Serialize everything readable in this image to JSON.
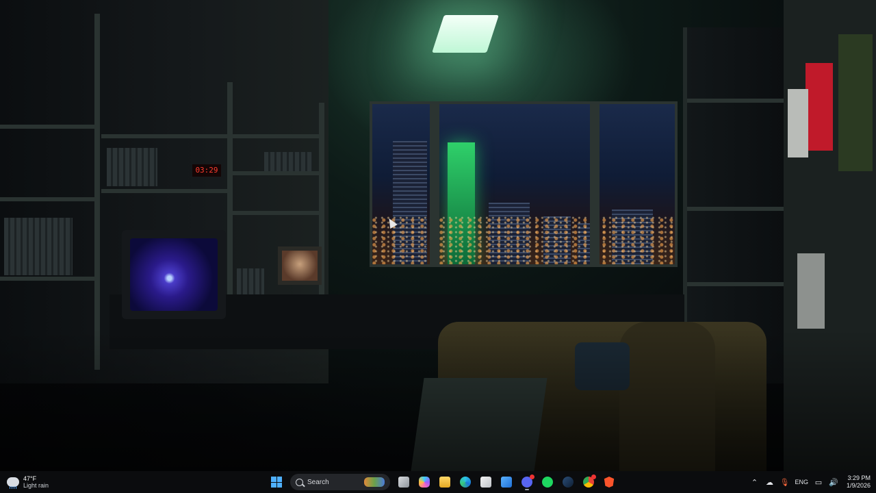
{
  "wallpaper": {
    "alarm_clock_text": "03:29"
  },
  "taskbar": {
    "weather": {
      "icon": "rain-cloud-icon",
      "temperature": "47°F",
      "condition": "Light rain"
    },
    "start_icon": "windows-start-icon",
    "search": {
      "placeholder": "Search"
    },
    "pinned_apps": [
      {
        "name": "Task View",
        "icon": "task-view-icon"
      },
      {
        "name": "Copilot",
        "icon": "copilot-icon"
      },
      {
        "name": "File Explorer",
        "icon": "folder-icon"
      },
      {
        "name": "Microsoft Edge",
        "icon": "edge-icon"
      },
      {
        "name": "Microsoft Store",
        "icon": "store-icon"
      },
      {
        "name": "Mail",
        "icon": "mail-icon"
      },
      {
        "name": "Discord",
        "icon": "discord-icon"
      },
      {
        "name": "Spotify",
        "icon": "spotify-icon"
      },
      {
        "name": "Steam",
        "icon": "steam-icon"
      },
      {
        "name": "Chrome",
        "icon": "chrome-icon"
      },
      {
        "name": "Brave",
        "icon": "brave-icon"
      }
    ],
    "tray": {
      "language": "ENG",
      "time": "3:29 PM",
      "date": "1/9/2026"
    },
    "accent_color": "#4fb0ff"
  }
}
